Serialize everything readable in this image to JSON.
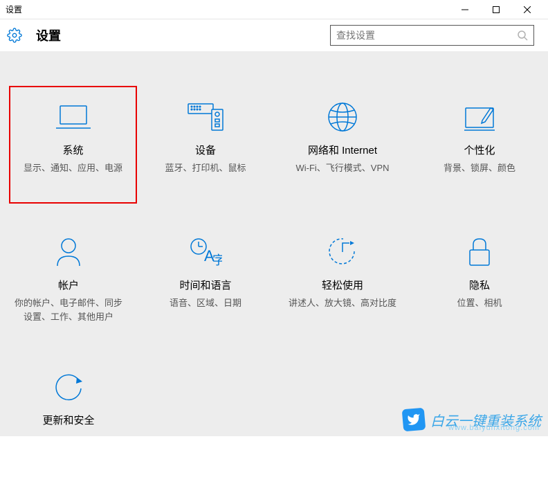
{
  "window": {
    "title": "设置"
  },
  "header": {
    "title": "设置"
  },
  "search": {
    "placeholder": "查找设置"
  },
  "items": [
    {
      "title": "系统",
      "desc": "显示、通知、应用、电源"
    },
    {
      "title": "设备",
      "desc": "蓝牙、打印机、鼠标"
    },
    {
      "title": "网络和 Internet",
      "desc": "Wi-Fi、飞行模式、VPN"
    },
    {
      "title": "个性化",
      "desc": "背景、锁屏、颜色"
    },
    {
      "title": "帐户",
      "desc": "你的帐户、电子邮件、同步设置、工作、其他用户"
    },
    {
      "title": "时间和语言",
      "desc": "语音、区域、日期"
    },
    {
      "title": "轻松使用",
      "desc": "讲述人、放大镜、高对比度"
    },
    {
      "title": "隐私",
      "desc": "位置、相机"
    },
    {
      "title": "更新和安全",
      "desc": ""
    }
  ],
  "watermark": {
    "text": "白云一键重装系统",
    "url": "www.baiyunxitong.com"
  },
  "colors": {
    "accent": "#0078d7",
    "highlight": "#e80000"
  }
}
